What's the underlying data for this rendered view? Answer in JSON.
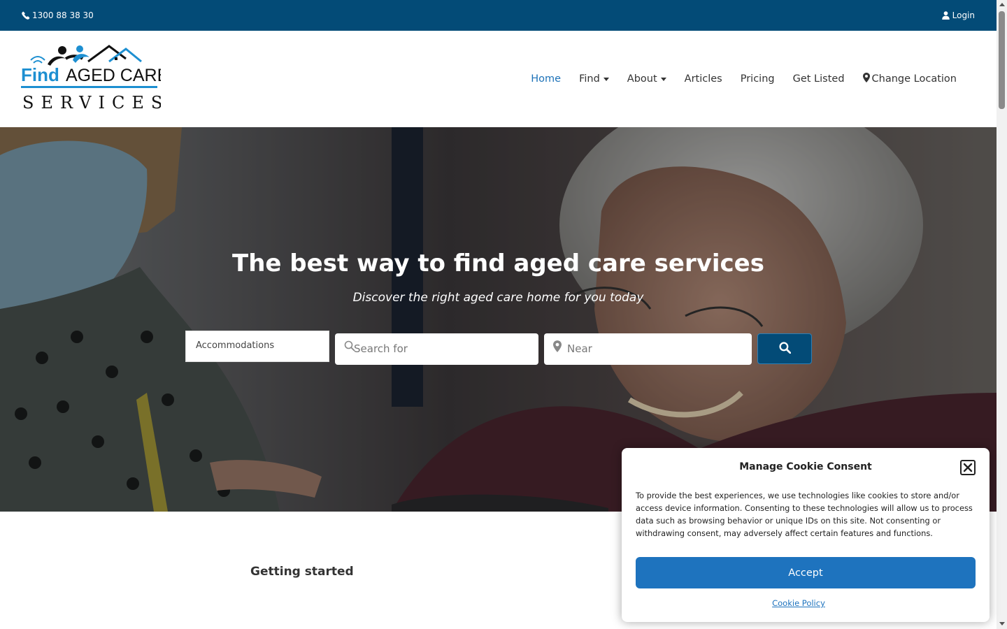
{
  "topbar": {
    "phone": "1300 88 38 30",
    "login_label": "Login",
    "background": "#034b77"
  },
  "logo": {
    "line1_find": "Find",
    "line1_rest": "AGED CARE",
    "line2": "SERVICES",
    "accent": "#1d8fd1"
  },
  "nav": {
    "items": [
      {
        "label": "Home",
        "active": true
      },
      {
        "label": "Find",
        "dropdown": true
      },
      {
        "label": "About",
        "dropdown": true
      },
      {
        "label": "Articles"
      },
      {
        "label": "Pricing"
      },
      {
        "label": "Get Listed"
      },
      {
        "label": "Change Location",
        "icon": "map-marker-icon"
      }
    ]
  },
  "hero": {
    "title": "The best way to find aged care services",
    "subtitle": "Discover the right aged care home for you today",
    "category_selected": "Accommodations",
    "search_placeholder": "Search for",
    "near_placeholder": "Near"
  },
  "section": {
    "getting_started": "Getting started"
  },
  "cookie": {
    "title": "Manage Cookie Consent",
    "body": "To provide the best experiences, we use technologies like cookies to store and/or access device information. Consenting to these technologies will allow us to process data such as browsing behavior or unique IDs on this site. Not consenting or withdrawing consent, may adversely affect certain features and functions.",
    "accept_label": "Accept",
    "policy_link": "Cookie Policy",
    "accent": "#1e73be"
  }
}
